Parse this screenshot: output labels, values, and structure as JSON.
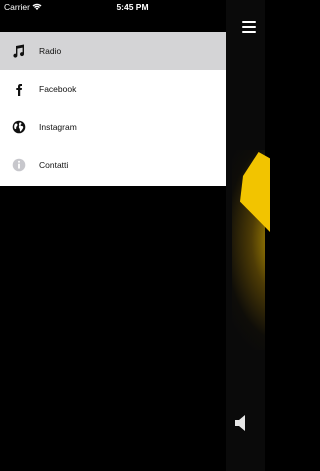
{
  "status": {
    "carrier": "Carrier",
    "time": "5:45 PM"
  },
  "menu": {
    "items": [
      {
        "label": "Radio",
        "icon": "music-note-icon",
        "active": true
      },
      {
        "label": "Facebook",
        "icon": "facebook-icon",
        "active": false
      },
      {
        "label": "Instagram",
        "icon": "globe-icon",
        "active": false
      },
      {
        "label": "Contatti",
        "icon": "info-icon",
        "active": false
      }
    ]
  },
  "colors": {
    "accent": "#f2c400",
    "drawer_bg": "#ffffff",
    "active_bg": "#d4d4d6",
    "background": "#000000"
  },
  "icons": {
    "menu": "hamburger-menu-icon",
    "volume": "speaker-icon"
  }
}
